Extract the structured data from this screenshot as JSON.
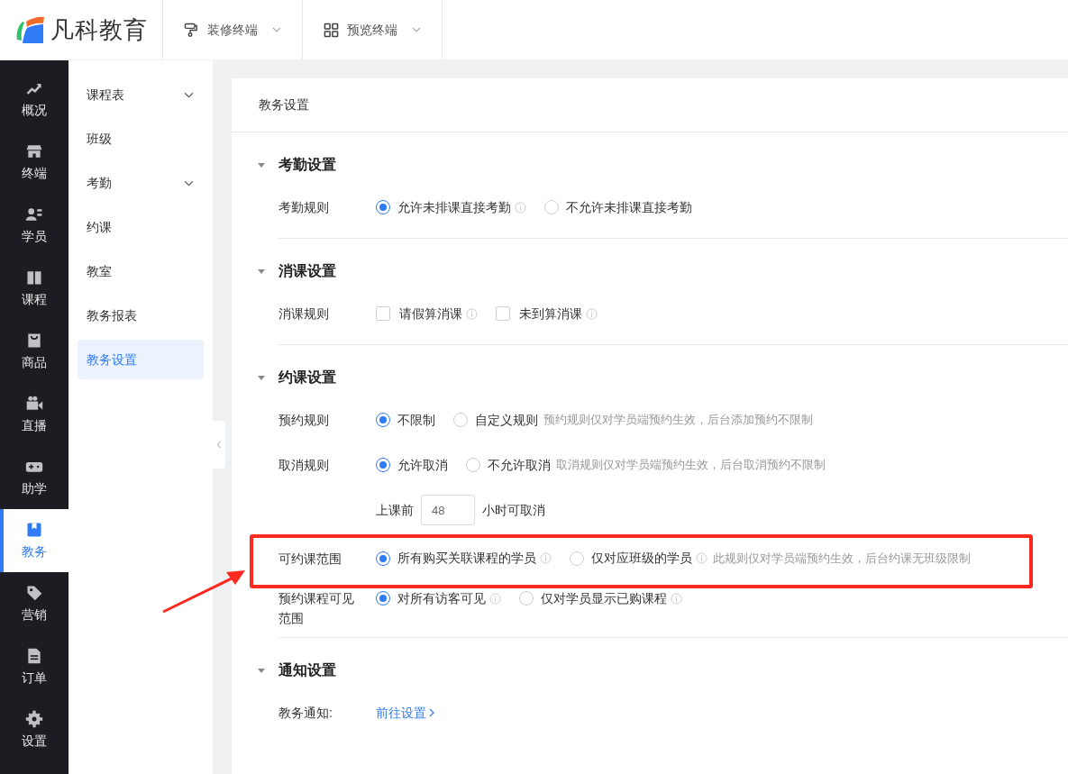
{
  "header": {
    "logo": "凡科教育",
    "menus": [
      {
        "label": "装修终端"
      },
      {
        "label": "预览终端"
      }
    ]
  },
  "rail": [
    {
      "label": "概况",
      "selected": false
    },
    {
      "label": "终端",
      "selected": false
    },
    {
      "label": "学员",
      "selected": false
    },
    {
      "label": "课程",
      "selected": false
    },
    {
      "label": "商品",
      "selected": false
    },
    {
      "label": "直播",
      "selected": false
    },
    {
      "label": "助学",
      "selected": false
    },
    {
      "label": "教务",
      "selected": true
    },
    {
      "label": "营销",
      "selected": false
    },
    {
      "label": "订单",
      "selected": false
    },
    {
      "label": "设置",
      "selected": false
    }
  ],
  "subnav": [
    {
      "label": "课程表",
      "selected": false,
      "expandable": true
    },
    {
      "label": "班级",
      "selected": false,
      "expandable": false
    },
    {
      "label": "考勤",
      "selected": false,
      "expandable": true
    },
    {
      "label": "约课",
      "selected": false,
      "expandable": false
    },
    {
      "label": "教室",
      "selected": false,
      "expandable": false
    },
    {
      "label": "教务报表",
      "selected": false,
      "expandable": false
    },
    {
      "label": "教务设置",
      "selected": true,
      "expandable": false
    }
  ],
  "page_title": "教务设置",
  "sections": [
    {
      "title": "考勤设置",
      "expanded": true,
      "rows": [
        {
          "kind": "radio",
          "label": "考勤规则",
          "options": [
            {
              "label": "允许未排课直接考勤",
              "selected": true,
              "info": true
            },
            {
              "label": "不允许未排课直接考勤",
              "selected": false,
              "info": false
            }
          ]
        }
      ]
    },
    {
      "title": "消课设置",
      "expanded": true,
      "rows": [
        {
          "kind": "checkbox",
          "label": "消课规则",
          "options": [
            {
              "label": "请假算消课",
              "checked": false,
              "info": true
            },
            {
              "label": "未到算消课",
              "checked": false,
              "info": true
            }
          ]
        }
      ]
    },
    {
      "title": "约课设置",
      "expanded": true,
      "rows": [
        {
          "kind": "radio",
          "label": "预约规则",
          "options": [
            {
              "label": "不限制",
              "selected": true,
              "info": false
            },
            {
              "label": "自定义规则",
              "selected": false,
              "info": false
            }
          ],
          "hint": "预约规则仅对学员端预约生效，后台添加预约不限制"
        },
        {
          "kind": "radio",
          "label": "取消规则",
          "options": [
            {
              "label": "允许取消",
              "selected": true,
              "info": false
            },
            {
              "label": "不允许取消",
              "selected": false,
              "info": false
            }
          ],
          "hint": "取消规则仅对学员端预约生效，后台取消预约不限制"
        },
        {
          "kind": "input",
          "prefix": "上课前",
          "value": "48",
          "suffix": "小时可取消"
        },
        {
          "kind": "radio",
          "label": "可约课范围",
          "highlighted": true,
          "options": [
            {
              "label": "所有购买关联课程的学员",
              "selected": true,
              "info": true
            },
            {
              "label": "仅对应班级的学员",
              "selected": false,
              "info": true
            }
          ],
          "hint": "此规则仅对学员端预约生效，后台约课无班级限制"
        },
        {
          "kind": "radio",
          "label": "预约课程可见范围",
          "options": [
            {
              "label": "对所有访客可见",
              "selected": true,
              "info": true
            },
            {
              "label": "仅对学员显示已购课程",
              "selected": false,
              "info": true
            }
          ]
        }
      ]
    },
    {
      "title": "通知设置",
      "expanded": true,
      "rows": [
        {
          "kind": "link",
          "label": "教务通知:",
          "link": "前往设置"
        }
      ]
    }
  ]
}
